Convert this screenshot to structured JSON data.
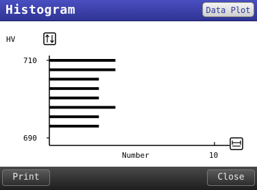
{
  "window": {
    "title": "Histogram"
  },
  "header": {
    "data_plot_label": "Data Plot"
  },
  "footer": {
    "print_label": "Print",
    "close_label": "Close"
  },
  "chart_data": {
    "type": "bar",
    "orientation": "horizontal",
    "ylabel": "HV",
    "xlabel": "Number",
    "y_ticks": [
      "710",
      "690"
    ],
    "x_ticks": [
      "10"
    ],
    "xlim": [
      0,
      10
    ],
    "bars": [
      {
        "value": 4
      },
      {
        "value": 4
      },
      {
        "value": 3
      },
      {
        "value": 3
      },
      {
        "value": 3
      },
      {
        "value": 4
      },
      {
        "value": 3
      },
      {
        "value": 3
      }
    ],
    "bar_color": "#000000",
    "grid": false
  },
  "icons": {
    "y_scale": "vertical-expand-icon",
    "x_scale": "horizontal-expand-icon"
  }
}
